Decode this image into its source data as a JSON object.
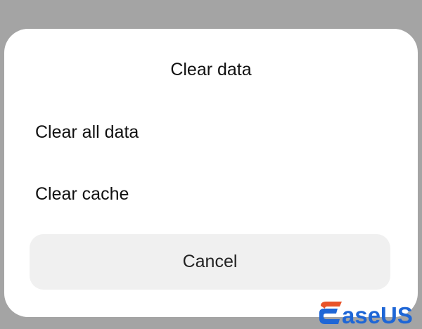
{
  "dialog": {
    "title": "Clear data",
    "options": [
      {
        "label": "Clear all data"
      },
      {
        "label": "Clear cache"
      }
    ],
    "cancel_label": "Cancel"
  },
  "watermark": {
    "text": "EaseUS",
    "colors": {
      "accent": "#e8542a",
      "primary": "#1e66d6"
    }
  },
  "colors": {
    "backdrop": "#a4a4a4",
    "dialog_background": "#ffffff",
    "cancel_background": "#f0f0f0",
    "text": "#111111"
  }
}
